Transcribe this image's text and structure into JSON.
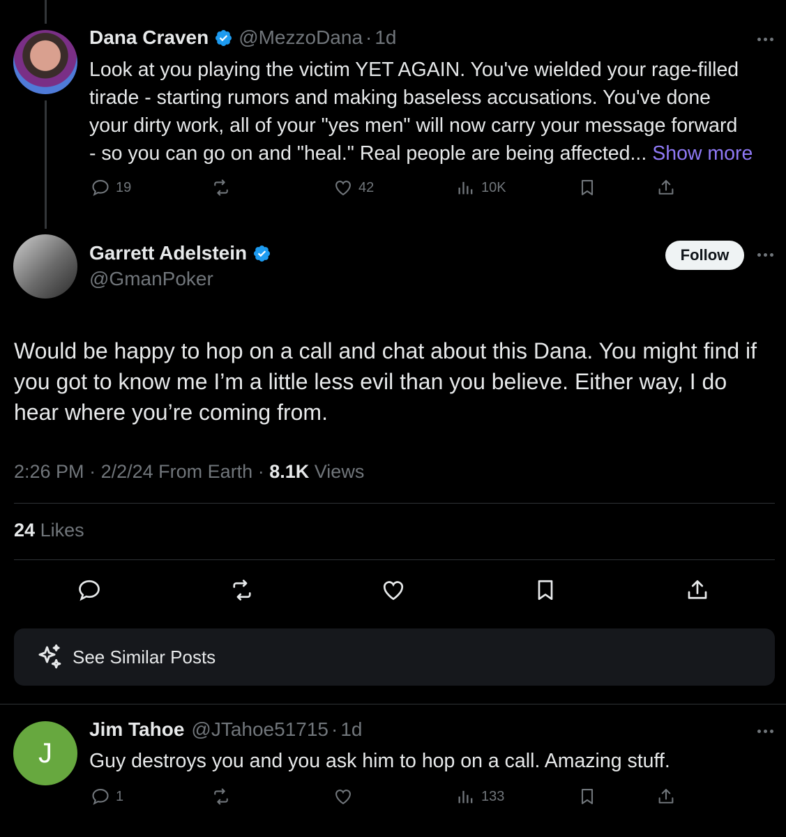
{
  "post1": {
    "name": "Dana Craven",
    "handle": "@MezzoDana",
    "time": "1d",
    "lines": [
      "Look at you playing the victim YET AGAIN. You've wielded your rage-filled",
      "tirade - starting rumors and making baseless accusations. You've done",
      "your dirty work, all of your \"yes men\" will now carry your message forward",
      "- so you can go on and \"heal.\" Real people are being affected..."
    ],
    "show_more": "Show more",
    "replies": "19",
    "likes": "42",
    "views": "10K"
  },
  "post2": {
    "name": "Garrett Adelstein",
    "handle": "@GmanPoker",
    "follow": "Follow",
    "text": "Would be happy to hop on a call and chat about this Dana. You might find if you got to know me I’m a little less evil than you believe. Either way, I do hear where you’re coming from.",
    "time": "2:26 PM",
    "date": "2/2/24",
    "source": "From Earth",
    "views_count": "8.1K",
    "views_label": "Views",
    "likes_count": "24",
    "likes_label": "Likes"
  },
  "similar": {
    "label": "See Similar Posts"
  },
  "post3": {
    "avatar_letter": "J",
    "name": "Jim Tahoe",
    "handle": "@JTahoe51715",
    "time": "1d",
    "text": "Guy destroys you and you ask him to hop on a call. Amazing stuff.",
    "replies": "1",
    "views": "133"
  },
  "colors": {
    "background": "#000000",
    "text": "#e7e9ea",
    "muted": "#71767b",
    "verified": "#1d9bf0",
    "show_more": "#8f79f5",
    "avatar_j": "#67a83f"
  },
  "icons": [
    "reply-icon",
    "repost-icon",
    "like-icon",
    "views-icon",
    "bookmark-icon",
    "share-icon",
    "verified-icon",
    "sparkle-icon",
    "more-icon"
  ]
}
